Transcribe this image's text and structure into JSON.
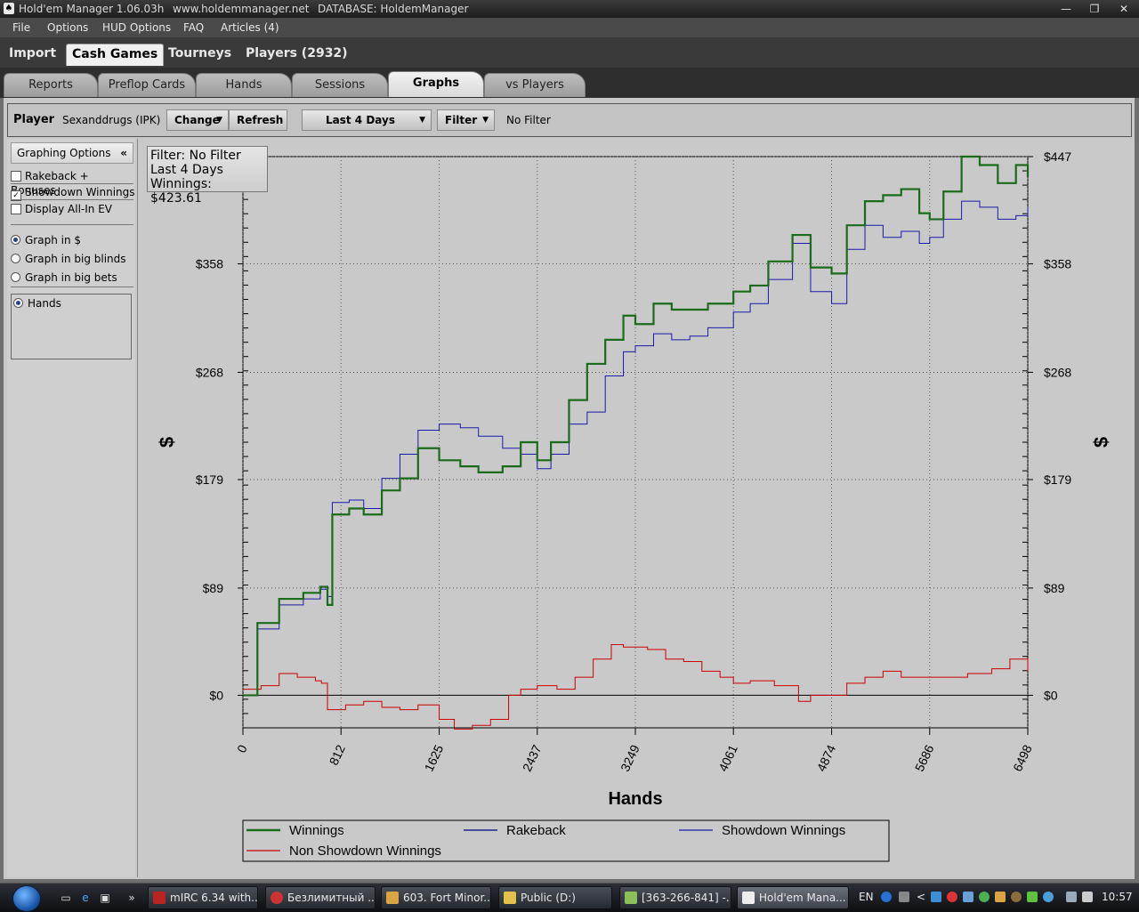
{
  "window": {
    "title": "Hold'em Manager 1.06.03h",
    "url": "www.holdemmanager.net",
    "database": "DATABASE: HoldemManager"
  },
  "menu": [
    "File",
    "Options",
    "HUD Options",
    "FAQ",
    "Articles (4)"
  ],
  "main_tabs": [
    "Import",
    "Cash Games",
    "Tourneys",
    "Players (2932)"
  ],
  "sub_tabs": [
    "Reports",
    "Preflop Cards",
    "Hands",
    "Sessions",
    "Graphs",
    "vs Players"
  ],
  "player_bar": {
    "label": "Player",
    "name": "Sexanddrugs (IPK)",
    "change_label": "Change",
    "refresh_label": "Refresh",
    "period": "Last 4 Days",
    "filter_label": "Filter",
    "filter_status": "No Filter"
  },
  "sidebar": {
    "header": "Graphing Options",
    "collapse_glyph": "«",
    "checkboxes": [
      {
        "label": "Rakeback + Bonuses",
        "checked": false
      },
      {
        "label": "Showdown Winnings",
        "checked": true
      },
      {
        "label": "Display All-In EV",
        "checked": false
      }
    ],
    "radios": [
      {
        "label": "Graph in $",
        "selected": true
      },
      {
        "label": "Graph in big blinds",
        "selected": false
      },
      {
        "label": "Graph in big bets",
        "selected": false
      }
    ],
    "x_axis_option": {
      "label": "Hands",
      "selected": true
    }
  },
  "info_box": {
    "line1": "Filter: No Filter",
    "line2": "Last 4 Days",
    "line3": "Winnings: $423.61"
  },
  "chart_data": {
    "type": "line",
    "xlabel": "Hands",
    "ylabel": "$",
    "xlim": [
      0,
      6498
    ],
    "ylim": [
      -27,
      447
    ],
    "x_ticks": [
      "0",
      "812",
      "1625",
      "2437",
      "3249",
      "4061",
      "4874",
      "5686",
      "6498"
    ],
    "y_ticks": [
      "$0",
      "$89",
      "$179",
      "$268",
      "$358",
      "$447"
    ],
    "y_tick_values": [
      0,
      89,
      179,
      268,
      358,
      447
    ],
    "grid": true,
    "legend_position": "bottom",
    "series": [
      {
        "name": "Winnings",
        "color": "#1a6b1a",
        "x": [
          0,
          120,
          300,
          500,
          640,
          700,
          740,
          880,
          1000,
          1150,
          1300,
          1450,
          1625,
          1800,
          1950,
          2150,
          2300,
          2437,
          2550,
          2700,
          2850,
          3000,
          3150,
          3249,
          3400,
          3550,
          3700,
          3850,
          4061,
          4200,
          4350,
          4550,
          4700,
          4874,
          5000,
          5150,
          5300,
          5450,
          5600,
          5686,
          5800,
          5950,
          6100,
          6250,
          6400,
          6498
        ],
        "y": [
          0,
          60,
          80,
          85,
          90,
          75,
          150,
          155,
          150,
          170,
          180,
          205,
          195,
          190,
          185,
          190,
          210,
          195,
          210,
          245,
          275,
          295,
          315,
          308,
          325,
          320,
          320,
          325,
          335,
          340,
          360,
          382,
          355,
          350,
          390,
          410,
          415,
          420,
          400,
          395,
          418,
          447,
          440,
          425,
          440,
          430
        ]
      },
      {
        "name": "Rakeback",
        "color": "#000080",
        "x": [],
        "y": []
      },
      {
        "name": "Showdown Winnings",
        "color": "#1a1aaa",
        "x": [
          0,
          120,
          300,
          500,
          640,
          700,
          740,
          880,
          1000,
          1150,
          1300,
          1450,
          1625,
          1800,
          1950,
          2150,
          2300,
          2437,
          2550,
          2700,
          2850,
          3000,
          3150,
          3249,
          3400,
          3550,
          3700,
          3850,
          4061,
          4200,
          4350,
          4550,
          4700,
          4874,
          5000,
          5150,
          5300,
          5450,
          5600,
          5686,
          5800,
          5950,
          6100,
          6250,
          6400,
          6498
        ],
        "y": [
          0,
          55,
          75,
          80,
          88,
          82,
          160,
          162,
          155,
          180,
          200,
          220,
          225,
          222,
          215,
          205,
          200,
          188,
          200,
          225,
          235,
          265,
          285,
          290,
          300,
          295,
          298,
          305,
          318,
          325,
          345,
          375,
          335,
          325,
          370,
          390,
          380,
          385,
          375,
          380,
          395,
          410,
          405,
          395,
          398,
          405
        ]
      },
      {
        "name": "Non Showdown Winnings",
        "color": "#cc0000",
        "x": [
          0,
          150,
          300,
          450,
          600,
          650,
          700,
          850,
          1000,
          1150,
          1300,
          1450,
          1625,
          1750,
          1900,
          2050,
          2200,
          2300,
          2437,
          2600,
          2750,
          2900,
          3050,
          3150,
          3249,
          3350,
          3500,
          3650,
          3800,
          3950,
          4061,
          4200,
          4400,
          4600,
          4700,
          4874,
          5000,
          5150,
          5300,
          5450,
          5600,
          5800,
          6000,
          6200,
          6350,
          6498
        ],
        "y": [
          5,
          8,
          18,
          15,
          12,
          10,
          -12,
          -8,
          -5,
          -10,
          -12,
          -8,
          -20,
          -28,
          -25,
          -20,
          0,
          5,
          8,
          5,
          15,
          30,
          42,
          40,
          40,
          38,
          30,
          28,
          20,
          15,
          10,
          12,
          8,
          -5,
          0,
          0,
          10,
          15,
          20,
          15,
          15,
          15,
          18,
          22,
          30,
          20
        ]
      }
    ]
  },
  "taskbar": {
    "items": [
      "mIRC 6.34 with...",
      "Безлимитный ...",
      "603. Fort Minor...",
      "Public (D:)",
      "[363-266-841] -...",
      "Hold'em Mana..."
    ],
    "lang": "EN",
    "clock": "10:57",
    "quick_launch_arrow": "»",
    "tray_arrow": "<"
  }
}
